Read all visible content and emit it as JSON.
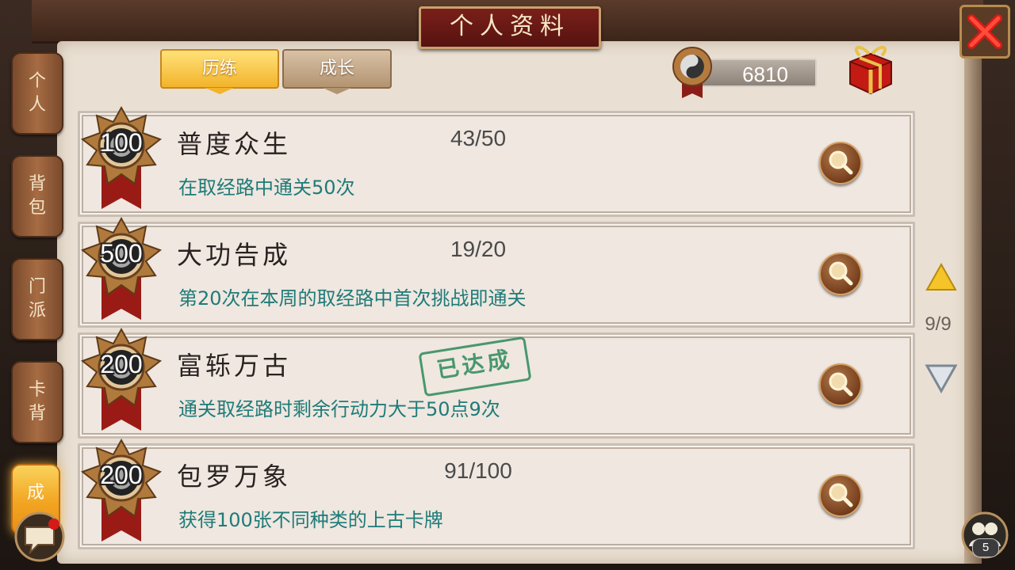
{
  "window": {
    "title": "个人资料"
  },
  "side_nav": [
    {
      "chars": [
        "个",
        "人"
      ],
      "active": false
    },
    {
      "chars": [
        "背",
        "包"
      ],
      "active": false
    },
    {
      "chars": [
        "门",
        "派"
      ],
      "active": false
    },
    {
      "chars": [
        "卡",
        "背"
      ],
      "active": false
    },
    {
      "chars": [
        "成"
      ],
      "active": true
    }
  ],
  "tabs": [
    {
      "label": "历练",
      "active": true
    },
    {
      "label": "成长",
      "active": false
    }
  ],
  "points": {
    "value": "6810"
  },
  "achievements": [
    {
      "medal": "100",
      "title": "普度众生",
      "progress": "43/50",
      "desc": "在取经路中通关50次",
      "completed": false
    },
    {
      "medal": "500",
      "title": "大功告成",
      "progress": "19/20",
      "desc": "第20次在本周的取经路中首次挑战即通关",
      "completed": false
    },
    {
      "medal": "200",
      "title": "富轹万古",
      "progress": "",
      "desc": "通关取经路时剩余行动力大于50点9次",
      "completed": true,
      "stamp": "已达成"
    },
    {
      "medal": "200",
      "title": "包罗万象",
      "progress": "91/100",
      "desc": "获得100张不同种类的上古卡牌",
      "completed": false
    }
  ],
  "pagination": {
    "label": "9/9"
  },
  "friends": {
    "count": "5"
  },
  "colors": {
    "accent": "#f3b32a",
    "desc_text": "#1e7b78",
    "stamp": "#2d8a5b"
  }
}
